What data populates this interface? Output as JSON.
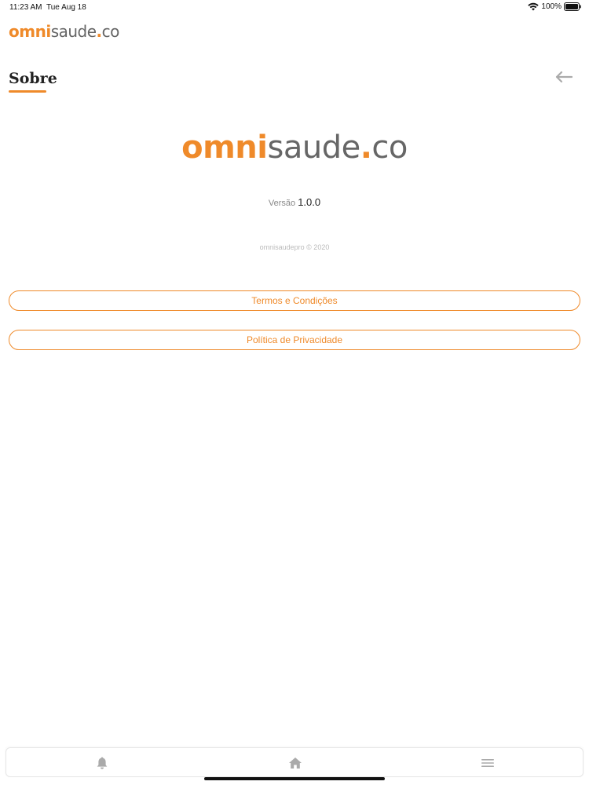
{
  "status_bar": {
    "time": "11:23 AM",
    "date": "Tue Aug 18",
    "battery": "100%",
    "icons": [
      "wifi-icon",
      "battery-icon"
    ]
  },
  "header": {
    "logo": {
      "part1": "omni",
      "part2": "saude",
      "part3": ".",
      "part4": "co"
    }
  },
  "page": {
    "title": "Sobre",
    "back_icon": "arrow-left-icon"
  },
  "about": {
    "logo": {
      "part1": "omni",
      "part2": "saude",
      "part3": ".",
      "part4": "co"
    },
    "version_label": "Versão",
    "version_value": "1.0.0",
    "copyright": "omnisaudepro © 2020"
  },
  "buttons": {
    "terms": "Termos e Condições",
    "privacy": "Política de Privacidade"
  },
  "bottom_nav": {
    "items": [
      {
        "icon": "bell-icon"
      },
      {
        "icon": "home-icon"
      },
      {
        "icon": "menu-icon"
      }
    ]
  },
  "colors": {
    "accent": "#ef8a2a",
    "brand_gray": "#666666",
    "icon_gray": "#aaaaaa"
  }
}
